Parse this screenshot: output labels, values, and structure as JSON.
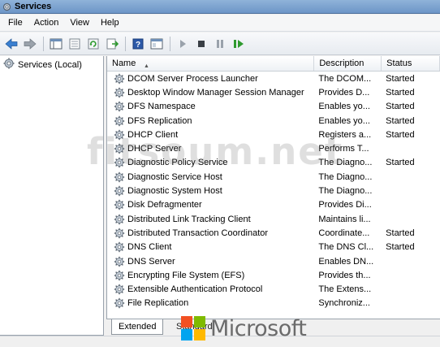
{
  "window": {
    "title": "Services"
  },
  "menu": [
    "File",
    "Action",
    "View",
    "Help"
  ],
  "toolbar": {
    "buttons": [
      "back-arrow-icon",
      "forward-arrow-icon",
      "show-hide-tree-icon",
      "properties-icon",
      "refresh-icon",
      "export-list-icon",
      "help-icon",
      "mmc-view-icon",
      "start-service-icon",
      "stop-service-icon",
      "pause-service-icon",
      "restart-service-icon"
    ]
  },
  "tree": {
    "root_label": "Services (Local)"
  },
  "list": {
    "columns": {
      "name": "Name",
      "description": "Description",
      "status": "Status"
    },
    "rows": [
      {
        "name": "DCOM Server Process Launcher",
        "description": "The DCOM...",
        "status": "Started"
      },
      {
        "name": "Desktop Window Manager Session Manager",
        "description": "Provides D...",
        "status": "Started"
      },
      {
        "name": "DFS Namespace",
        "description": "Enables yo...",
        "status": "Started"
      },
      {
        "name": "DFS Replication",
        "description": "Enables yo...",
        "status": "Started"
      },
      {
        "name": "DHCP Client",
        "description": "Registers a...",
        "status": "Started"
      },
      {
        "name": "DHCP Server",
        "description": "Performs T...",
        "status": ""
      },
      {
        "name": "Diagnostic Policy Service",
        "description": "The Diagno...",
        "status": "Started"
      },
      {
        "name": "Diagnostic Service Host",
        "description": "The Diagno...",
        "status": ""
      },
      {
        "name": "Diagnostic System Host",
        "description": "The Diagno...",
        "status": ""
      },
      {
        "name": "Disk Defragmenter",
        "description": "Provides Di...",
        "status": ""
      },
      {
        "name": "Distributed Link Tracking Client",
        "description": "Maintains li...",
        "status": ""
      },
      {
        "name": "Distributed Transaction Coordinator",
        "description": "Coordinate...",
        "status": "Started"
      },
      {
        "name": "DNS Client",
        "description": "The DNS Cl...",
        "status": "Started"
      },
      {
        "name": "DNS Server",
        "description": "Enables DN...",
        "status": ""
      },
      {
        "name": "Encrypting File System (EFS)",
        "description": "Provides th...",
        "status": ""
      },
      {
        "name": "Extensible Authentication Protocol",
        "description": "The Extens...",
        "status": ""
      },
      {
        "name": "File Replication",
        "description": "Synchroniz...",
        "status": ""
      }
    ]
  },
  "tabs": {
    "extended": "Extended",
    "standard": "Standard"
  },
  "overlay": {
    "watermark": "fitsoum.net",
    "logo_word": "Microsoft"
  },
  "colors": {
    "title_bar": "#7ea4d1",
    "ms_red": "#f25022",
    "ms_green": "#7fba00",
    "ms_blue": "#00a4ef",
    "ms_yellow": "#ffb900"
  }
}
